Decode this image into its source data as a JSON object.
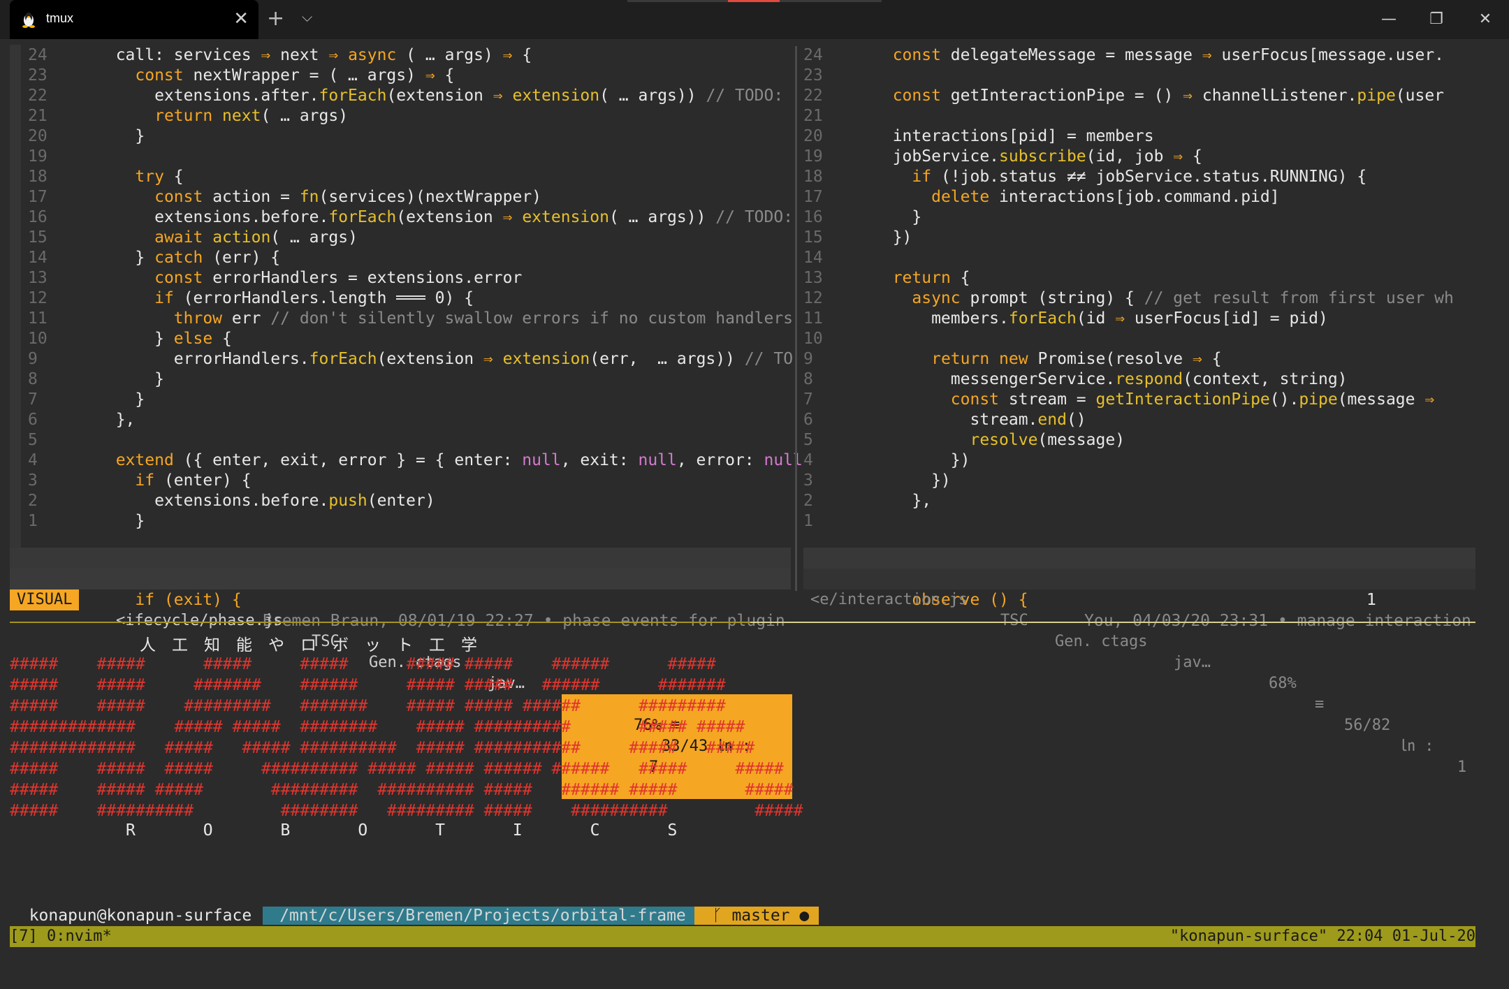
{
  "window": {
    "tab_title": "tmux",
    "new_tab": "+",
    "tab_menu": "⌵",
    "close_tab": "✕",
    "minimize": "—",
    "restore": "❐",
    "close": "✕"
  },
  "left_pane": {
    "lines": [
      {
        "n": "24",
        "t": "  call: services ⇒ next ⇒ async ( … args) ⇒ {"
      },
      {
        "n": "23",
        "t": "    const nextWrapper = ( … args) ⇒ {"
      },
      {
        "n": "22",
        "t": "      extensions.after.forEach(extension ⇒ extension( … args)) // TODO:"
      },
      {
        "n": "21",
        "t": "      return next( … args)"
      },
      {
        "n": "20",
        "t": "    }"
      },
      {
        "n": "19",
        "t": ""
      },
      {
        "n": "18",
        "t": "    try {"
      },
      {
        "n": "17",
        "t": "      const action = fn(services)(nextWrapper)"
      },
      {
        "n": "16",
        "t": "      extensions.before.forEach(extension ⇒ extension( … args)) // TODO:"
      },
      {
        "n": "15",
        "t": "      await action( … args)"
      },
      {
        "n": "14",
        "t": "    } catch (err) {"
      },
      {
        "n": "13",
        "t": "      const errorHandlers = extensions.error"
      },
      {
        "n": "12",
        "t": "      if (errorHandlers.length ═══ 0) {"
      },
      {
        "n": "11",
        "t": "        throw err // don't silently swallow errors if no custom handlers"
      },
      {
        "n": "10",
        "t": "      } else {"
      },
      {
        "n": "9",
        "t": "        errorHandlers.forEach(extension ⇒ extension(err,  … args)) // TO"
      },
      {
        "n": "8",
        "t": "      }"
      },
      {
        "n": "7",
        "t": "    }"
      },
      {
        "n": "6",
        "t": "  },"
      },
      {
        "n": "5",
        "t": ""
      },
      {
        "n": "4",
        "t": "  extend ({ enter, exit, error } = { enter: null, exit: null, error: null"
      },
      {
        "n": "3",
        "t": "    if (enter) {"
      },
      {
        "n": "2",
        "t": "      extensions.before.push(enter)"
      },
      {
        "n": "1",
        "t": "    }"
      }
    ],
    "current_line_number": "33",
    "current_line_text": "    if (exit) {",
    "blame": "Bremen Braun, 08/01/19 22:27 • phase events for plugin",
    "status": {
      "mode": "VISUAL",
      "file": "<ifecycle/phase.js",
      "lsp": "TSC",
      "tags": "Gen. ctags",
      "filetype": "jav…",
      "percent": "76%",
      "position": "33/43",
      "column": "7"
    }
  },
  "right_pane": {
    "lines": [
      {
        "n": "24",
        "t": "  const delegateMessage = message ⇒ userFocus[message.user."
      },
      {
        "n": "23",
        "t": ""
      },
      {
        "n": "22",
        "t": "  const getInteractionPipe = () ⇒ channelListener.pipe(user"
      },
      {
        "n": "21",
        "t": ""
      },
      {
        "n": "20",
        "t": "  interactions[pid] = members"
      },
      {
        "n": "19",
        "t": "  jobService.subscribe(id, job ⇒ {"
      },
      {
        "n": "18",
        "t": "    if (!job.status ≠≠ jobService.status.RUNNING) {"
      },
      {
        "n": "17",
        "t": "      delete interactions[job.command.pid]"
      },
      {
        "n": "16",
        "t": "    }"
      },
      {
        "n": "15",
        "t": "  })"
      },
      {
        "n": "14",
        "t": ""
      },
      {
        "n": "13",
        "t": "  return {"
      },
      {
        "n": "12",
        "t": "    async prompt (string) { // get result from first user wh"
      },
      {
        "n": "11",
        "t": "      members.forEach(id ⇒ userFocus[id] = pid)"
      },
      {
        "n": "10",
        "t": ""
      },
      {
        "n": "9",
        "t": "      return new Promise(resolve ⇒ {"
      },
      {
        "n": "8",
        "t": "        messengerService.respond(context, string)"
      },
      {
        "n": "7",
        "t": "        const stream = getInteractionPipe().pipe(message ⇒"
      },
      {
        "n": "6",
        "t": "          stream.end()"
      },
      {
        "n": "5",
        "t": "          resolve(message)"
      },
      {
        "n": "4",
        "t": "        })"
      },
      {
        "n": "3",
        "t": "      })"
      },
      {
        "n": "2",
        "t": "    },"
      },
      {
        "n": "1",
        "t": ""
      }
    ],
    "current_line_number": "56",
    "current_line_text": "    observe () {",
    "blame": "You, 04/03/20 23:31 • manage interaction",
    "status": {
      "file": "<e/interaction.js",
      "lsp": "TSC",
      "tags": "Gen. ctags",
      "filetype": "jav…",
      "percent": "68%",
      "position": "56/82",
      "column": "1"
    }
  },
  "shell": {
    "counter": "1",
    "banner_title": "人　工　知　能　や　ロ　ボ　ッ　ト　工　学",
    "banner_art": [
      "#####    #####      #####     #####      ##### #####    ######      #####",
      "#####    #####     #######    ######     ##### #####   ######      #######",
      "#####    #####    #########   #######    ##### ##### ######      #########",
      "#############    ##### #####  ########    ##### ##########       ##### #####",
      "#############   #####   ##### ##########  ##### ###########     #####   #####",
      "#####    #####  #####     ########## ##### ##### ###### ######   #####     #####",
      "#####    ##### #####       #########  ########## #####   ###### #####       #####",
      "#####    ##########         ########   ######### #####    ##########         #####"
    ],
    "banner_word": "R       O       B       O       T       I       C       S",
    "prompt_user": "konapun@konapun-surface",
    "prompt_path": "/mnt/c/Users/Bremen/Projects/orbital-frame",
    "prompt_branch": "ᚴ master ●"
  },
  "tmux_status": {
    "left": "[7] 0:nvim*",
    "right": "\"konapun-surface\" 22:04 01-Jul-20"
  },
  "colors": {
    "accent": "#f5a623",
    "ascii_red": "#e0352e",
    "tmux_bar": "#9e9a1c",
    "path_bg": "#2f7b8c"
  }
}
